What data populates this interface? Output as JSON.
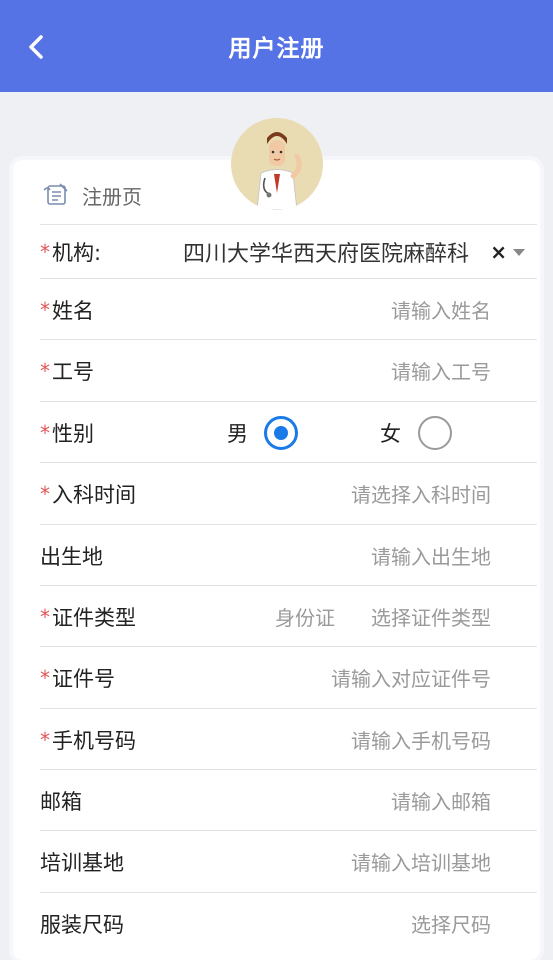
{
  "header": {
    "title": "用户注册"
  },
  "page_label": "注册页",
  "form": {
    "org": {
      "label": "机构:",
      "value": "四川大学华西天府医院麻醉科",
      "clear_icon": "×"
    },
    "name": {
      "label": "姓名",
      "placeholder": "请输入姓名"
    },
    "staff_id": {
      "label": "工号",
      "placeholder": "请输入工号"
    },
    "gender": {
      "label": "性别",
      "male": "男",
      "female": "女",
      "selected": "男"
    },
    "entry_time": {
      "label": "入科时间",
      "placeholder": "请选择入科时间"
    },
    "birthplace": {
      "label": "出生地",
      "placeholder": "请输入出生地"
    },
    "id_type": {
      "label": "证件类型",
      "value": "身份证",
      "action": "选择证件类型"
    },
    "id_number": {
      "label": "证件号",
      "placeholder": "请输入对应证件号"
    },
    "phone": {
      "label": "手机号码",
      "placeholder": "请输入手机号码"
    },
    "email": {
      "label": "邮箱",
      "placeholder": "请输入邮箱"
    },
    "training_base": {
      "label": "培训基地",
      "placeholder": "请输入培训基地"
    },
    "clothing_size": {
      "label": "服装尺码",
      "action": "选择尺码"
    }
  },
  "required_mark": "*",
  "colors": {
    "header": "#5673e6",
    "accent": "#1a7ae8",
    "required": "#e25555"
  }
}
